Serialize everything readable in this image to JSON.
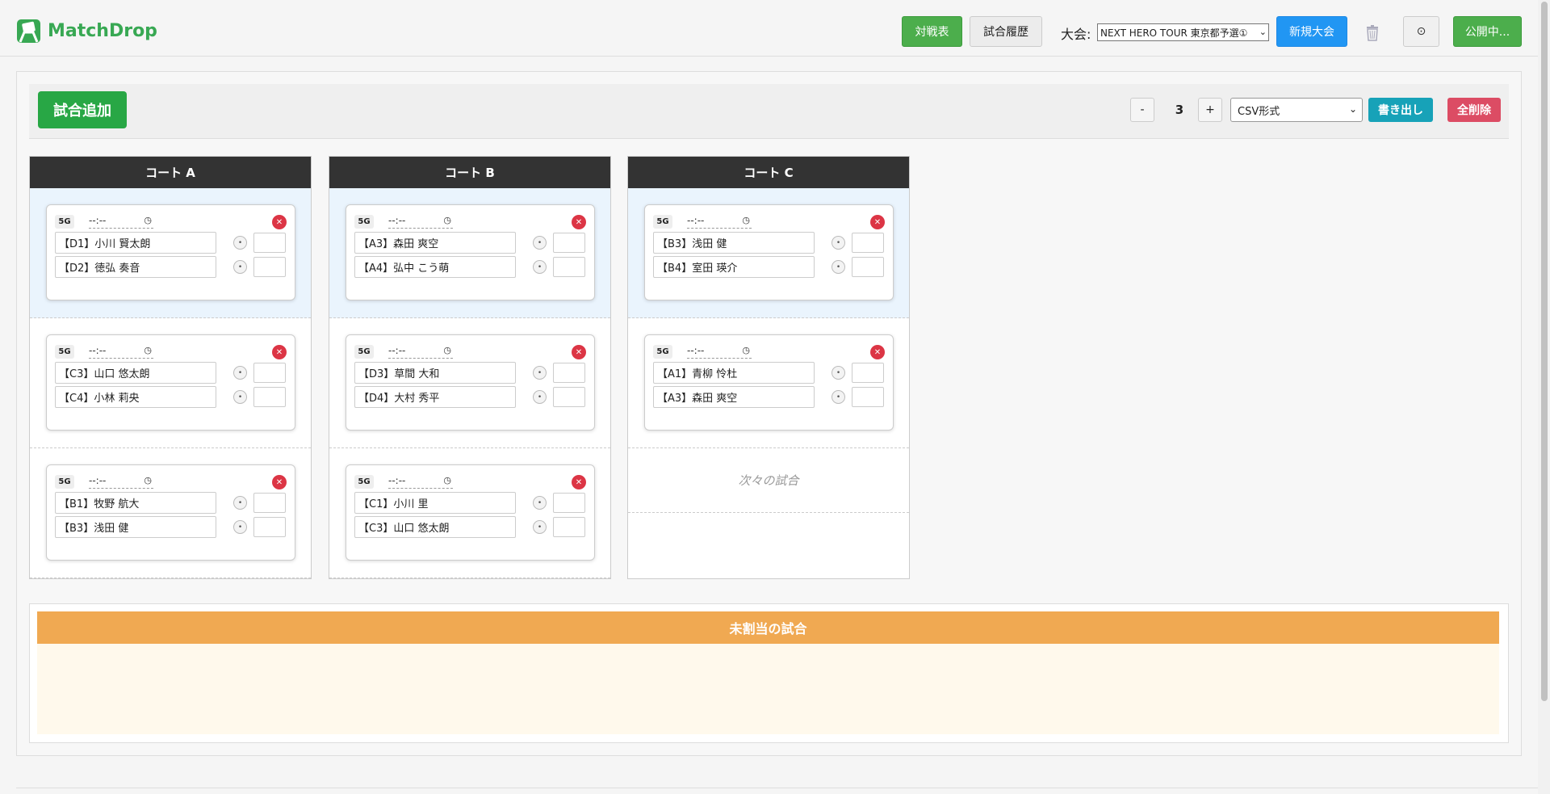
{
  "app": {
    "title": "MatchDrop"
  },
  "header": {
    "bracket_btn": "対戦表",
    "history_btn": "試合履歴",
    "tournament_label": "大会:",
    "tournament_selected": "NEXT HERO TOUR 東京都予選①",
    "new_tournament_btn": "新規大会",
    "settings_icon": "gear-icon",
    "settings_label": "⊙",
    "publish_btn": "公開中..."
  },
  "toolbar": {
    "add_match_btn": "試合追加",
    "minus": "-",
    "court_count": "3",
    "plus": "+",
    "format_selected": "CSV形式",
    "export_btn": "書き出し",
    "clear_all_btn": "全削除"
  },
  "courts": [
    {
      "name": "コート A",
      "matches": [
        {
          "games": "5G",
          "time": "--:--",
          "p1": "【D1】小川 賢太朗",
          "p2": "【D2】徳弘 奏音"
        },
        {
          "games": "5G",
          "time": "--:--",
          "p1": "【C3】山口 悠太朗",
          "p2": "【C4】小林 莉央"
        },
        {
          "games": "5G",
          "time": "--:--",
          "p1": "【B1】牧野 航大",
          "p2": "【B3】浅田 健"
        }
      ]
    },
    {
      "name": "コート B",
      "matches": [
        {
          "games": "5G",
          "time": "--:--",
          "p1": "【A3】森田 爽空",
          "p2": "【A4】弘中 こう萌"
        },
        {
          "games": "5G",
          "time": "--:--",
          "p1": "【D3】草間 大和",
          "p2": "【D4】大村 秀平"
        },
        {
          "games": "5G",
          "time": "--:--",
          "p1": "【C1】小川 里",
          "p2": "【C3】山口 悠太朗"
        }
      ]
    },
    {
      "name": "コート C",
      "matches": [
        {
          "games": "5G",
          "time": "--:--",
          "p1": "【B3】浅田 健",
          "p2": "【B4】室田 瑛介"
        },
        {
          "games": "5G",
          "time": "--:--",
          "p1": "【A1】青柳 怜杜",
          "p2": "【A3】森田 爽空"
        }
      ],
      "next_placeholder": "次々の試合"
    }
  ],
  "unassigned": {
    "title": "未割当の試合"
  },
  "colors": {
    "brand": "#38a853",
    "court_head": "#333333",
    "unassigned_head": "#f0a952"
  }
}
